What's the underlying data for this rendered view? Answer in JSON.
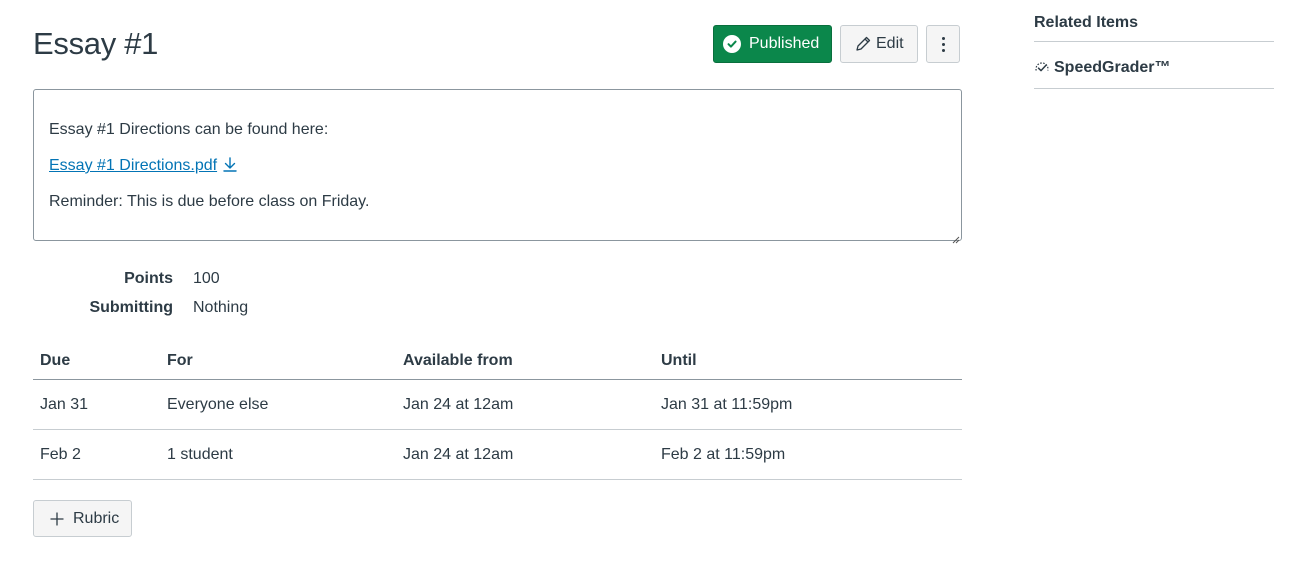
{
  "page": {
    "title": "Essay #1"
  },
  "header_actions": {
    "published_label": "Published",
    "edit_label": "Edit"
  },
  "description": {
    "intro": "Essay #1 Directions can be found here:",
    "file_link": "Essay #1 Directions.pdf",
    "reminder": "Reminder: This is due before class on Friday."
  },
  "details": [
    {
      "label": "Points",
      "value": "100"
    },
    {
      "label": "Submitting",
      "value": "Nothing"
    }
  ],
  "dates_table": {
    "headers": [
      "Due",
      "For",
      "Available from",
      "Until"
    ],
    "rows": [
      [
        "Jan 31",
        "Everyone else",
        "Jan 24 at 12am",
        "Jan 31 at 11:59pm"
      ],
      [
        "Feb 2",
        "1 student",
        "Jan 24 at 12am",
        "Feb 2 at 11:59pm"
      ]
    ]
  },
  "rubric_button": {
    "label": "Rubric"
  },
  "sidebar": {
    "heading": "Related Items",
    "items": [
      {
        "label": "SpeedGrader™",
        "icon": "speedgrader-icon"
      }
    ]
  },
  "colors": {
    "published_green": "#0b874b",
    "link_blue": "#0374b5",
    "text": "#2d3b45"
  }
}
